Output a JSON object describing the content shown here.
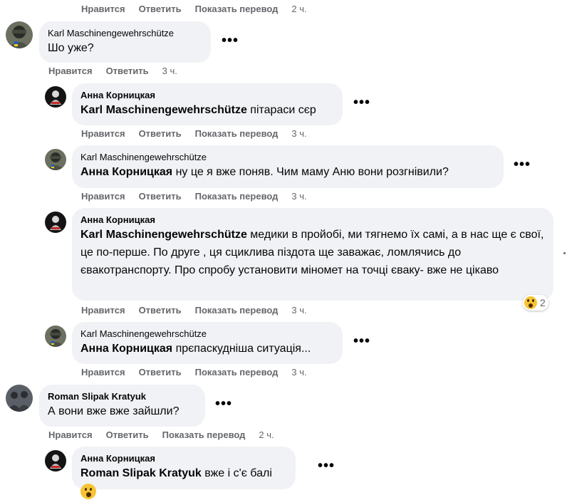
{
  "labels": {
    "like": "Нравится",
    "reply": "Ответить",
    "translate": "Показать перевод",
    "more": "•••"
  },
  "top_actions": {
    "time": "2 ч."
  },
  "comments": [
    {
      "author": "Karl Maschinengewehrschütze",
      "text": "Шо уже?",
      "time": "3 ч."
    },
    {
      "author": "Анна Корницкая",
      "mention": "Karl Maschinengewehrschütze",
      "text": " пітараси сєр",
      "time": "3 ч."
    },
    {
      "author": "Karl Maschinengewehrschütze",
      "mention": "Анна Корницкая",
      "text": " ну це я вже поняв. Чим маму Аню вони розгнівили?",
      "time": "3 ч."
    },
    {
      "author": "Анна Корницкая",
      "mention": "Karl Maschinengewehrschütze",
      "text": " медики в пройобі, ми тягнемо їх самі, а в нас ще є свої, це по-перше. По друге , ця сциклива піздота ще заважає, ломлячись до євакотранспорту. Про спробу установити міномет на точці єваку- вже не цікаво",
      "time": "3 ч.",
      "reaction": {
        "icon": "wow-emoji-icon",
        "count": "2"
      }
    },
    {
      "author": "Karl Maschinengewehrschütze",
      "mention": "Анна Корницкая",
      "text": " прєпаскудніша ситуація...",
      "time": "3 ч."
    },
    {
      "author": "Roman Slipak Kratyuk",
      "text": "А вони вже вже зайшли?",
      "time": "2 ч."
    },
    {
      "author": "Анна Корницкая",
      "mention": "Roman Slipak Kratyuk",
      "text": " вже і с'є балі",
      "inline_emoji": "wow-emoji-icon"
    }
  ],
  "colors": {
    "bubble": "#f0f2f5",
    "meta": "#65676b",
    "text": "#050505"
  }
}
